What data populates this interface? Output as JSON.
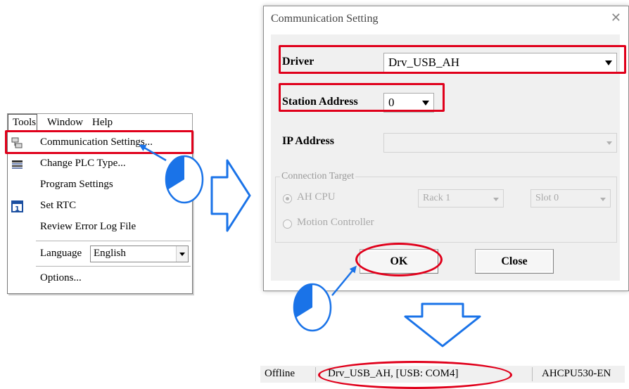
{
  "menubar": {
    "items": [
      "Tools",
      "Window",
      "Help"
    ]
  },
  "tools_menu": {
    "items": [
      {
        "label": "Communication Settings...",
        "icon": "communication-icon"
      },
      {
        "label": "Change PLC Type...",
        "icon": "plc-type-icon"
      },
      {
        "label": "Program Settings",
        "icon": ""
      },
      {
        "label": "Set RTC",
        "icon": "rtc-calendar-icon"
      },
      {
        "label": "Review Error Log File",
        "icon": ""
      }
    ],
    "language": {
      "label": "Language",
      "value": "English"
    },
    "options": "Options..."
  },
  "dialog": {
    "title": "Communication Setting",
    "driver": {
      "label": "Driver",
      "value": "Drv_USB_AH"
    },
    "station": {
      "label": "Station Address",
      "value": "0"
    },
    "ip": {
      "label": "IP Address",
      "value": ""
    },
    "connection_target": {
      "title": "Connection Target",
      "ah_cpu": "AH CPU",
      "rack": "Rack 1",
      "slot": "Slot 0",
      "motion": "Motion Controller"
    },
    "ok": "OK",
    "close": "Close"
  },
  "statusbar": {
    "state": "Offline",
    "driver": "Drv_USB_AH, [USB: COM4]",
    "cpu": "AHCPU530-EN"
  },
  "colors": {
    "highlight_red": "#e0001b",
    "arrow_blue": "#1a73e8"
  }
}
